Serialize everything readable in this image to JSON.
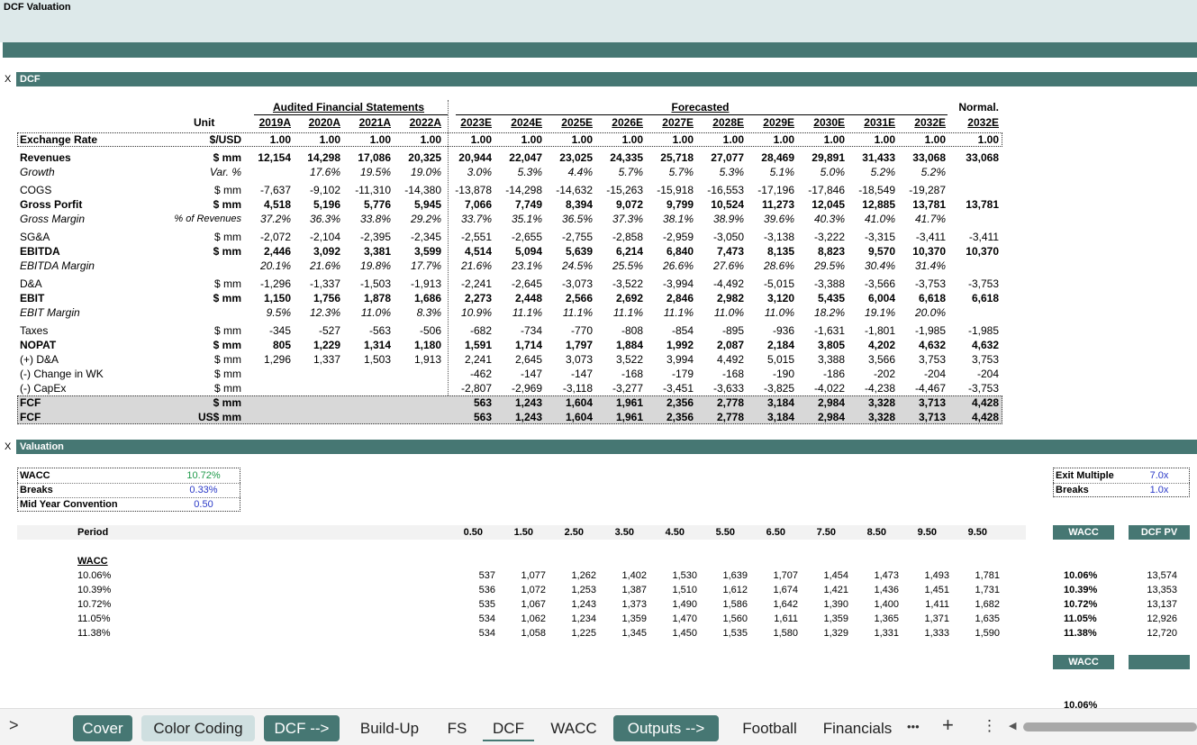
{
  "sheet_title": "DCF Valuation",
  "dcf_section": {
    "marker": "X",
    "title": "DCF"
  },
  "headers": {
    "audited": "Audited Financial Statements",
    "forecasted": "Forecasted",
    "normal": "Normal.",
    "unit": "Unit",
    "years": [
      "2019A",
      "2020A",
      "2021A",
      "2022A",
      "2023E",
      "2024E",
      "2025E",
      "2026E",
      "2027E",
      "2028E",
      "2029E",
      "2030E",
      "2031E",
      "2032E",
      "2032E"
    ]
  },
  "rows": [
    {
      "key": "exrate",
      "label": "Exchange Rate",
      "unit": "$/USD",
      "style": "b",
      "values": [
        "1.00",
        "1.00",
        "1.00",
        "1.00",
        "1.00",
        "1.00",
        "1.00",
        "1.00",
        "1.00",
        "1.00",
        "1.00",
        "1.00",
        "1.00",
        "1.00",
        "1.00"
      ]
    },
    {
      "key": "rev",
      "label": "Revenues",
      "unit": "$ mm",
      "style": "b",
      "values": [
        "12,154",
        "14,298",
        "17,086",
        "20,325",
        "20,944",
        "22,047",
        "23,025",
        "24,335",
        "25,718",
        "27,077",
        "28,469",
        "29,891",
        "31,433",
        "33,068",
        "33,068"
      ]
    },
    {
      "key": "growth",
      "label": "Growth",
      "unit": "Var. %",
      "style": "i",
      "values": [
        "",
        "17.6%",
        "19.5%",
        "19.0%",
        "3.0%",
        "5.3%",
        "4.4%",
        "5.7%",
        "5.7%",
        "5.3%",
        "5.1%",
        "5.0%",
        "5.2%",
        "5.2%",
        ""
      ]
    },
    {
      "key": "cogs",
      "label": "COGS",
      "unit": "$ mm",
      "style": "",
      "values": [
        "-7,637",
        "-9,102",
        "-11,310",
        "-14,380",
        "-13,878",
        "-14,298",
        "-14,632",
        "-15,263",
        "-15,918",
        "-16,553",
        "-17,196",
        "-17,846",
        "-18,549",
        "-19,287",
        ""
      ]
    },
    {
      "key": "gp",
      "label": "Gross Porfit",
      "unit": "$ mm",
      "style": "b",
      "values": [
        "4,518",
        "5,196",
        "5,776",
        "5,945",
        "7,066",
        "7,749",
        "8,394",
        "9,072",
        "9,799",
        "10,524",
        "11,273",
        "12,045",
        "12,885",
        "13,781",
        "13,781"
      ]
    },
    {
      "key": "gm",
      "label": "Gross Margin",
      "unit": "% of Revenues",
      "style": "i",
      "values": [
        "37.2%",
        "36.3%",
        "33.8%",
        "29.2%",
        "33.7%",
        "35.1%",
        "36.5%",
        "37.3%",
        "38.1%",
        "38.9%",
        "39.6%",
        "40.3%",
        "41.0%",
        "41.7%",
        ""
      ]
    },
    {
      "key": "sga",
      "label": "SG&A",
      "unit": "$ mm",
      "style": "",
      "values": [
        "-2,072",
        "-2,104",
        "-2,395",
        "-2,345",
        "-2,551",
        "-2,655",
        "-2,755",
        "-2,858",
        "-2,959",
        "-3,050",
        "-3,138",
        "-3,222",
        "-3,315",
        "-3,411",
        "-3,411"
      ]
    },
    {
      "key": "ebitda",
      "label": "EBITDA",
      "unit": "$ mm",
      "style": "b",
      "values": [
        "2,446",
        "3,092",
        "3,381",
        "3,599",
        "4,514",
        "5,094",
        "5,639",
        "6,214",
        "6,840",
        "7,473",
        "8,135",
        "8,823",
        "9,570",
        "10,370",
        "10,370"
      ]
    },
    {
      "key": "ebitdam",
      "label": "EBITDA Margin",
      "unit": "",
      "style": "i",
      "values": [
        "20.1%",
        "21.6%",
        "19.8%",
        "17.7%",
        "21.6%",
        "23.1%",
        "24.5%",
        "25.5%",
        "26.6%",
        "27.6%",
        "28.6%",
        "29.5%",
        "30.4%",
        "31.4%",
        ""
      ]
    },
    {
      "key": "da",
      "label": "D&A",
      "unit": "$ mm",
      "style": "",
      "values": [
        "-1,296",
        "-1,337",
        "-1,503",
        "-1,913",
        "-2,241",
        "-2,645",
        "-3,073",
        "-3,522",
        "-3,994",
        "-4,492",
        "-5,015",
        "-3,388",
        "-3,566",
        "-3,753",
        "-3,753"
      ]
    },
    {
      "key": "ebit",
      "label": "EBIT",
      "unit": "$ mm",
      "style": "b",
      "values": [
        "1,150",
        "1,756",
        "1,878",
        "1,686",
        "2,273",
        "2,448",
        "2,566",
        "2,692",
        "2,846",
        "2,982",
        "3,120",
        "5,435",
        "6,004",
        "6,618",
        "6,618"
      ]
    },
    {
      "key": "ebitm",
      "label": "EBIT Margin",
      "unit": "",
      "style": "i",
      "values": [
        "9.5%",
        "12.3%",
        "11.0%",
        "8.3%",
        "10.9%",
        "11.1%",
        "11.1%",
        "11.1%",
        "11.1%",
        "11.0%",
        "11.0%",
        "18.2%",
        "19.1%",
        "20.0%",
        ""
      ]
    },
    {
      "key": "tax",
      "label": "Taxes",
      "unit": "$ mm",
      "style": "",
      "values": [
        "-345",
        "-527",
        "-563",
        "-506",
        "-682",
        "-734",
        "-770",
        "-808",
        "-854",
        "-895",
        "-936",
        "-1,631",
        "-1,801",
        "-1,985",
        "-1,985"
      ]
    },
    {
      "key": "nopat",
      "label": "NOPAT",
      "unit": "$ mm",
      "style": "b",
      "values": [
        "805",
        "1,229",
        "1,314",
        "1,180",
        "1,591",
        "1,714",
        "1,797",
        "1,884",
        "1,992",
        "2,087",
        "2,184",
        "3,805",
        "4,202",
        "4,632",
        "4,632"
      ]
    },
    {
      "key": "pda",
      "label": "(+) D&A",
      "unit": "$ mm",
      "style": "",
      "values": [
        "1,296",
        "1,337",
        "1,503",
        "1,913",
        "2,241",
        "2,645",
        "3,073",
        "3,522",
        "3,994",
        "4,492",
        "5,015",
        "3,388",
        "3,566",
        "3,753",
        "3,753"
      ]
    },
    {
      "key": "wk",
      "label": "(-) Change in WK",
      "unit": "$ mm",
      "style": "",
      "values": [
        "",
        "",
        "",
        "",
        "-462",
        "-147",
        "-147",
        "-168",
        "-179",
        "-168",
        "-190",
        "-186",
        "-202",
        "-204",
        "-204"
      ]
    },
    {
      "key": "capex",
      "label": "(-) CapEx",
      "unit": "$ mm",
      "style": "",
      "values": [
        "",
        "",
        "",
        "",
        "-2,807",
        "-2,969",
        "-3,118",
        "-3,277",
        "-3,451",
        "-3,633",
        "-3,825",
        "-4,022",
        "-4,238",
        "-4,467",
        "-3,753"
      ]
    },
    {
      "key": "fcf",
      "label": "FCF",
      "unit": "$ mm",
      "style": "b",
      "values": [
        "",
        "",
        "",
        "",
        "563",
        "1,243",
        "1,604",
        "1,961",
        "2,356",
        "2,778",
        "3,184",
        "2,984",
        "3,328",
        "3,713",
        "4,428"
      ]
    },
    {
      "key": "fcfusd",
      "label": "FCF",
      "unit": "US$ mm",
      "style": "b",
      "values": [
        "",
        "",
        "",
        "",
        "563",
        "1,243",
        "1,604",
        "1,961",
        "2,356",
        "2,778",
        "3,184",
        "2,984",
        "3,328",
        "3,713",
        "4,428"
      ]
    }
  ],
  "valuation_section": {
    "marker": "X",
    "title": "Valuation"
  },
  "inputs": [
    {
      "label": "WACC",
      "value": "10.72%",
      "color": "green"
    },
    {
      "label": "Breaks",
      "value": "0.33%",
      "color": "blue"
    },
    {
      "label": "Mid Year Convention",
      "value": "0.50",
      "color": "blue"
    }
  ],
  "exit_inputs": [
    {
      "label": "Exit Multiple",
      "value": "7.0x"
    },
    {
      "label": "Breaks",
      "value": "1.0x"
    }
  ],
  "period": {
    "label": "Period",
    "values": [
      "0.50",
      "1.50",
      "2.50",
      "3.50",
      "4.50",
      "5.50",
      "6.50",
      "7.50",
      "8.50",
      "9.50",
      "9.50"
    ]
  },
  "sens": {
    "wacc_label": "WACC",
    "rows": [
      {
        "wacc": "10.06%",
        "values": [
          "537",
          "1,077",
          "1,262",
          "1,402",
          "1,530",
          "1,639",
          "1,707",
          "1,454",
          "1,473",
          "1,493",
          "1,781"
        ]
      },
      {
        "wacc": "10.39%",
        "values": [
          "536",
          "1,072",
          "1,253",
          "1,387",
          "1,510",
          "1,612",
          "1,674",
          "1,421",
          "1,436",
          "1,451",
          "1,731"
        ]
      },
      {
        "wacc": "10.72%",
        "values": [
          "535",
          "1,067",
          "1,243",
          "1,373",
          "1,490",
          "1,586",
          "1,642",
          "1,390",
          "1,400",
          "1,411",
          "1,682"
        ]
      },
      {
        "wacc": "11.05%",
        "values": [
          "534",
          "1,062",
          "1,234",
          "1,359",
          "1,470",
          "1,560",
          "1,611",
          "1,359",
          "1,365",
          "1,371",
          "1,635"
        ]
      },
      {
        "wacc": "11.38%",
        "values": [
          "534",
          "1,058",
          "1,225",
          "1,345",
          "1,450",
          "1,535",
          "1,580",
          "1,329",
          "1,331",
          "1,333",
          "1,590"
        ]
      }
    ]
  },
  "dcfpv": {
    "wacc_header": "WACC",
    "pv_header": "DCF PV",
    "rows": [
      {
        "wacc": "10.06%",
        "pv": "13,574"
      },
      {
        "wacc": "10.39%",
        "pv": "13,353"
      },
      {
        "wacc": "10.72%",
        "pv": "13,137"
      },
      {
        "wacc": "11.05%",
        "pv": "12,926"
      },
      {
        "wacc": "11.38%",
        "pv": "12,720"
      }
    ],
    "second_header": "WACC",
    "partial_value": "10.06%"
  },
  "tabs": {
    "nav_arrow": ">",
    "items": [
      {
        "label": "Cover",
        "kind": "dark"
      },
      {
        "label": "Color Coding",
        "kind": "light"
      },
      {
        "label": "DCF -->",
        "kind": "dark"
      },
      {
        "label": "Build-Up",
        "kind": "plain"
      },
      {
        "label": "FS",
        "kind": "plain"
      },
      {
        "label": "DCF",
        "kind": "active"
      },
      {
        "label": "WACC",
        "kind": "plain"
      },
      {
        "label": "Outputs -->",
        "kind": "dark"
      },
      {
        "label": "Football",
        "kind": "plain"
      },
      {
        "label": "Financials",
        "kind": "plain"
      }
    ],
    "more": "•••",
    "add": "+",
    "menu": "⋮",
    "scroll_left": "◀"
  }
}
